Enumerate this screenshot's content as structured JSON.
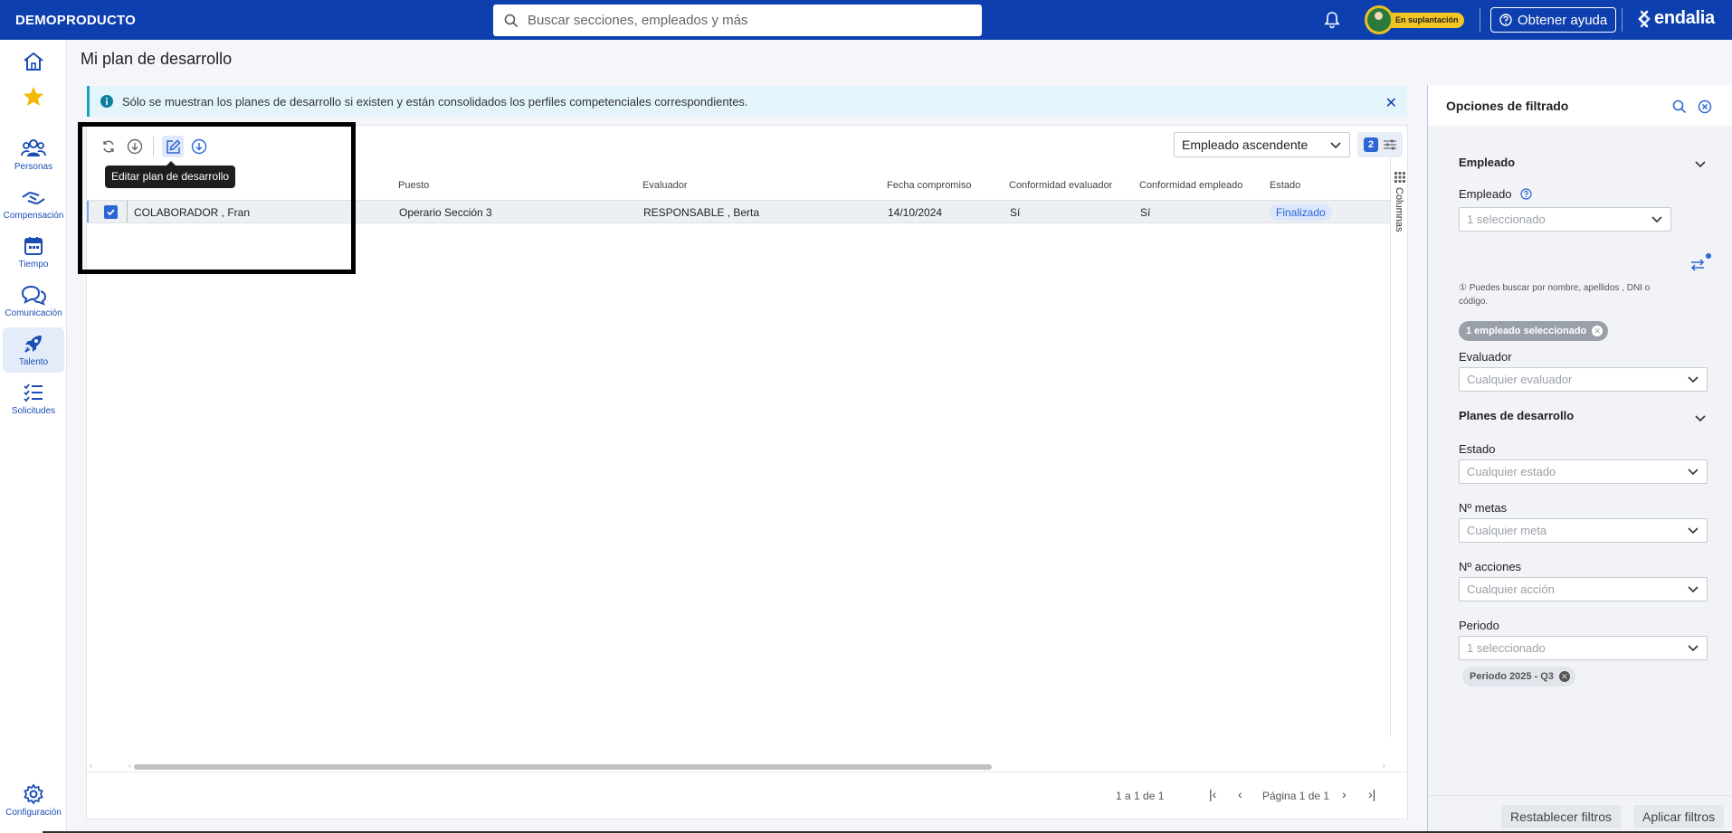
{
  "header": {
    "brand": "DEMOPRODUCTO",
    "search_placeholder": "Buscar secciones, empleados y más",
    "impersonation_badge": "En suplantación",
    "help_label": "Obtener ayuda",
    "logo_text": "endalia",
    "bg_color": "#0e3fae"
  },
  "sidebar": {
    "items": [
      {
        "label": "",
        "icon": "home-icon"
      },
      {
        "label": "",
        "icon": "star-icon"
      },
      {
        "label": "Personas",
        "icon": "people-icon"
      },
      {
        "label": "Compensación",
        "icon": "compensation-icon"
      },
      {
        "label": "Tiempo",
        "icon": "calendar-icon"
      },
      {
        "label": "Comunicación",
        "icon": "chat-icon"
      },
      {
        "label": "Talento",
        "icon": "rocket-icon",
        "active": true
      },
      {
        "label": "Solicitudes",
        "icon": "checklist-icon"
      },
      {
        "label": "Configuración",
        "icon": "gear-icon"
      }
    ]
  },
  "page": {
    "title": "Mi plan de desarrollo",
    "info_banner": "Sólo se muestran los planes de desarrollo si existen y están consolidados los perfiles competenciales correspondientes.",
    "tooltip": "Editar plan de desarrollo"
  },
  "grid": {
    "sort_value": "Empleado ascendente",
    "columns_count": "2",
    "columns_side_label": "Columnas",
    "headers": [
      "Puesto",
      "Evaluador",
      "Fecha compromiso",
      "Conformidad evaluador",
      "Conformidad empleado",
      "Estado"
    ],
    "rows": [
      {
        "selected": true,
        "empleado": "COLABORADOR , Fran",
        "puesto": "Operario Sección 3",
        "evaluador": "RESPONSABLE , Berta",
        "fecha": "14/10/2024",
        "conf_evaluador": "Sí",
        "conf_empleado": "Sí",
        "estado": "Finalizado"
      }
    ],
    "pager_count": "1 a 1 de 1",
    "pager_page": "Página 1 de 1"
  },
  "filters": {
    "title": "Opciones de filtrado",
    "sections": {
      "empleado_title": "Empleado",
      "planes_title": "Planes de desarrollo"
    },
    "empleado": {
      "label": "Empleado",
      "value": "1 seleccionado",
      "hint": "① Puedes buscar por nombre, apellidos , DNI o código.",
      "chip": "1 empleado seleccionado"
    },
    "evaluador": {
      "label": "Evaluador",
      "placeholder": "Cualquier evaluador"
    },
    "estado": {
      "label": "Estado",
      "placeholder": "Cualquier estado"
    },
    "metas": {
      "label": "Nº metas",
      "placeholder": "Cualquier meta"
    },
    "acciones": {
      "label": "Nº acciones",
      "placeholder": "Cualquier acción"
    },
    "periodo": {
      "label": "Periodo",
      "value": "1 seleccionado",
      "chip": "Periodo 2025 - Q3"
    },
    "reset_label": "Restablecer filtros",
    "apply_label": "Aplicar filtros"
  }
}
